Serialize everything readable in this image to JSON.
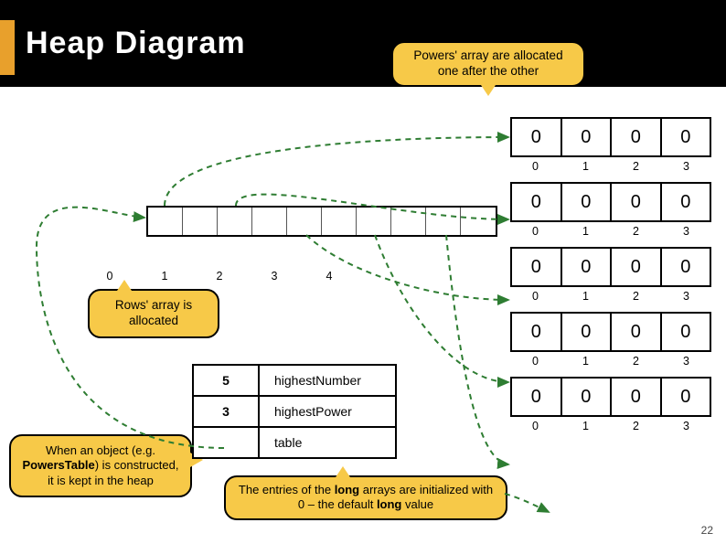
{
  "title": "Heap Diagram",
  "callouts": {
    "top": "Powers' array are allocated one after the other",
    "rows": "Rows' array is allocated",
    "heap_html": "When an object (e.g. <b>PowersTable</b>) is constructed, it is kept in the heap",
    "entries_html": "The entries of the <b>long</b> arrays are initialized with 0 – the default <b>long</b> value"
  },
  "rows_indices": [
    "0",
    "1",
    "2",
    "3",
    "4"
  ],
  "object_fields": [
    {
      "value": "5",
      "label": "highestNumber"
    },
    {
      "value": "3",
      "label": "highestPower"
    },
    {
      "value": "",
      "label": "table"
    }
  ],
  "mini_arrays": [
    {
      "cells": [
        "0",
        "0",
        "0",
        "0"
      ],
      "idx": [
        "0",
        "1",
        "2",
        "3"
      ]
    },
    {
      "cells": [
        "0",
        "0",
        "0",
        "0"
      ],
      "idx": [
        "0",
        "1",
        "2",
        "3"
      ]
    },
    {
      "cells": [
        "0",
        "0",
        "0",
        "0"
      ],
      "idx": [
        "0",
        "1",
        "2",
        "3"
      ]
    },
    {
      "cells": [
        "0",
        "0",
        "0",
        "0"
      ],
      "idx": [
        "0",
        "1",
        "2",
        "3"
      ]
    },
    {
      "cells": [
        "0",
        "0",
        "0",
        "0"
      ],
      "idx": [
        "0",
        "1",
        "2",
        "3"
      ]
    }
  ],
  "slide_number": "22"
}
